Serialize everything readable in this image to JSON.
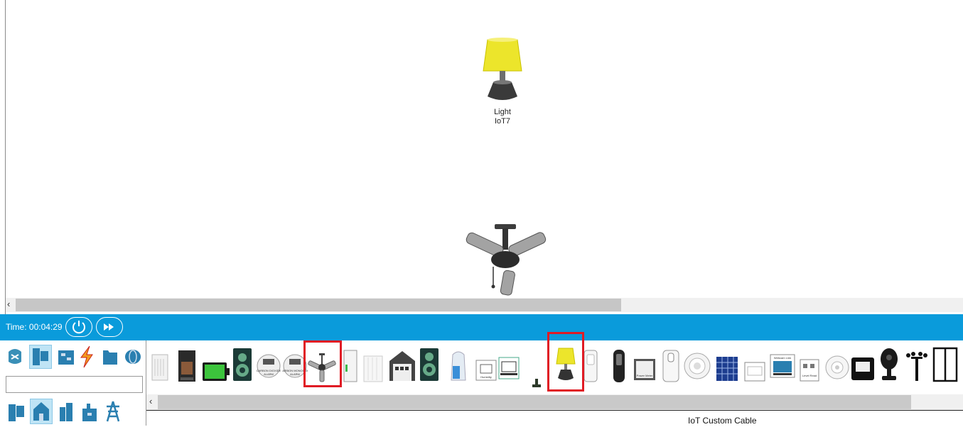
{
  "workspace": {
    "devices": [
      {
        "name": "Light",
        "id_label": "IoT7",
        "icon": "lamp-icon"
      },
      {
        "name": "",
        "id_label": "",
        "icon": "ceiling-fan-icon"
      }
    ]
  },
  "timebar": {
    "time_text": "Time: 00:04:29",
    "buttons": [
      "power-cycle-icon",
      "fast-forward-icon"
    ]
  },
  "categories": {
    "top_row": [
      "network-devices-icon",
      "end-devices-icon",
      "components-icon",
      "connections-icon",
      "miscellaneous-icon",
      "multiuser-icon"
    ],
    "bottom_row": [
      "end-devices-sub-icon",
      "home-icon",
      "smart-city-icon",
      "industrial-icon",
      "power-grid-icon"
    ],
    "search_value": ""
  },
  "device_strip": {
    "items": [
      "air-conditioner-icon",
      "coffee-maker-icon",
      "battery-icon",
      "speaker-icon",
      "carbon-dioxide-alarm-icon",
      "carbon-monoxide-alarm-icon",
      "ceiling-fan-icon",
      "door-icon",
      "radiator-icon",
      "garage-door-icon",
      "home-speaker-icon",
      "humidifier-icon",
      "humidity-monitor-icon",
      "laptop-icon",
      "lawn-sprinkler-icon",
      "light-icon",
      "motion-detector-icon",
      "portable-music-player-icon",
      "power-meter-icon",
      "rfid-card-reader-icon",
      "smoke-detector-icon",
      "solar-panel-icon",
      "thermostat-icon",
      "webcam-monitor-icon",
      "wind-detector-icon",
      "smart-sensor-icon",
      "trip-sensor-icon",
      "webcam-icon",
      "wind-turbine-icon",
      "window-icon"
    ],
    "selected": [
      "ceiling-fan-icon",
      "light-icon"
    ]
  },
  "status": {
    "cable_label": "IoT Custom Cable"
  },
  "colors": {
    "timebar": "#0a9bdb",
    "highlight": "#e01b24",
    "lamp_shade": "#e8e22a"
  }
}
